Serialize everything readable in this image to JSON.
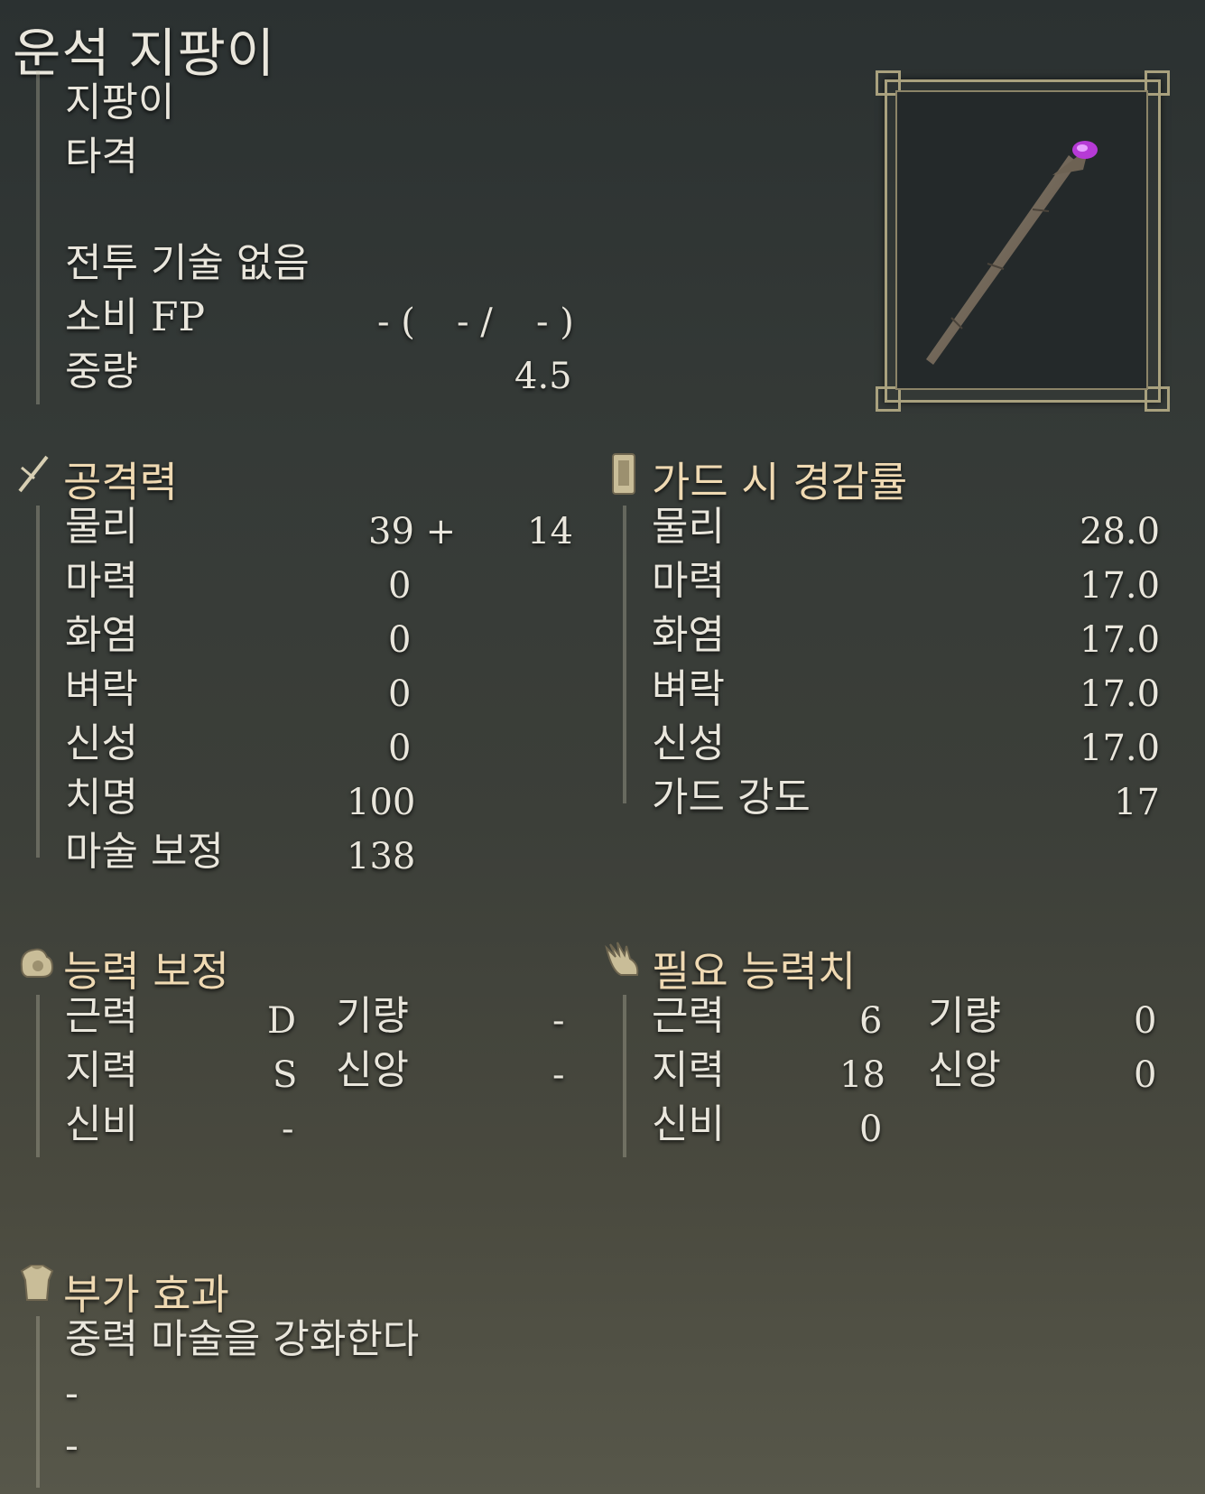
{
  "title": "운석 지팡이",
  "item": {
    "type": "지팡이",
    "attack_type": "타격"
  },
  "skill": {
    "name": "전투 기술 없음"
  },
  "fp": {
    "label": "소비 FP",
    "v1": "- (",
    "v2": "- /",
    "v3": "- )"
  },
  "weight": {
    "label": "중량",
    "value": "4.5"
  },
  "attack": {
    "header": "공격력",
    "rows": [
      {
        "label": "물리",
        "value": "39 +",
        "extra": "14"
      },
      {
        "label": "마력",
        "value": "0"
      },
      {
        "label": "화염",
        "value": "0"
      },
      {
        "label": "벼락",
        "value": "0"
      },
      {
        "label": "신성",
        "value": "0"
      },
      {
        "label": "치명",
        "value": "100"
      },
      {
        "label": "마술 보정",
        "value": "138"
      }
    ]
  },
  "guard": {
    "header": "가드 시 경감률",
    "rows": [
      {
        "label": "물리",
        "value": "28.0"
      },
      {
        "label": "마력",
        "value": "17.0"
      },
      {
        "label": "화염",
        "value": "17.0"
      },
      {
        "label": "벼락",
        "value": "17.0"
      },
      {
        "label": "신성",
        "value": "17.0"
      },
      {
        "label": "가드 강도",
        "value": "17"
      }
    ]
  },
  "scaling": {
    "header": "능력 보정",
    "rows": [
      {
        "label": "근력",
        "value": "D",
        "label2": "기량",
        "value2": "-"
      },
      {
        "label": "지력",
        "value": "S",
        "label2": "신앙",
        "value2": "-"
      },
      {
        "label": "신비",
        "value": "-"
      }
    ]
  },
  "requirements": {
    "header": "필요 능력치",
    "rows": [
      {
        "label": "근력",
        "value": "6",
        "label2": "기량",
        "value2": "0"
      },
      {
        "label": "지력",
        "value": "18",
        "label2": "신앙",
        "value2": "0"
      },
      {
        "label": "신비",
        "value": "0"
      }
    ]
  },
  "effects": {
    "header": "부가 효과",
    "lines": [
      "중력 마술을 강화한다",
      "-",
      "-"
    ]
  },
  "colors": {
    "header": "#efd9b2",
    "text": "#e9e6dc",
    "frame": "#a9a17e",
    "crystal": "#b63ad6"
  },
  "icons": [
    "sword-icon",
    "shield-icon",
    "arm-icon",
    "hand-icon",
    "armor-icon"
  ]
}
